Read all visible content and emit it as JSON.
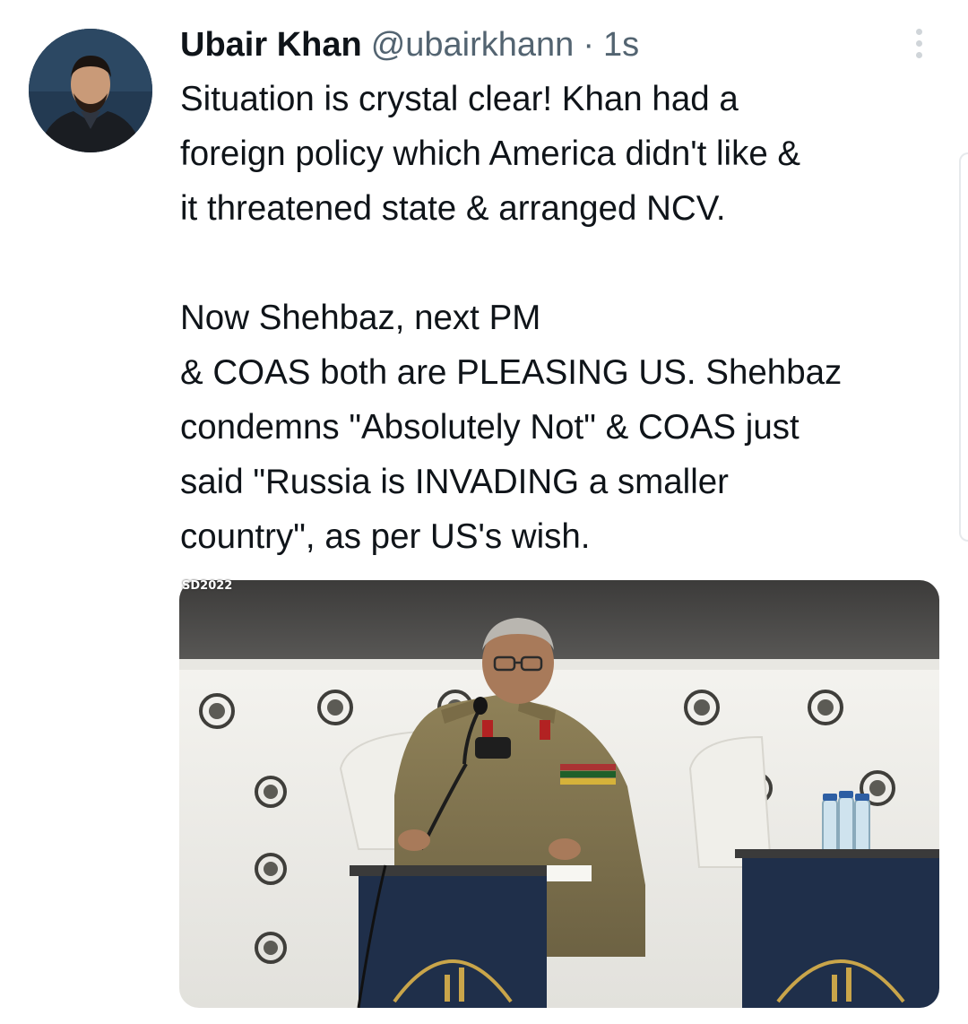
{
  "tweet": {
    "author": {
      "display_name": "Ubair Khan",
      "handle": "@ubairkhann",
      "avatar_icon": "profile-photo"
    },
    "separator": "·",
    "timestamp": "1s",
    "more_icon": "more-options-icon",
    "text_lines_para1": [
      "Situation is crystal clear! Khan had a",
      "foreign policy which America didn't like &",
      "it threatened state & arranged NCV."
    ],
    "text_lines_para2": [
      "Now Shehbaz, next PM",
      "& COAS both are PLEASING US. Shehbaz",
      "condemns \"Absolutely Not\" & COAS just",
      "said \"Russia is INVADING a smaller",
      "country\", as per US's wish."
    ],
    "media": {
      "watermark": "SD2022",
      "type": "photo"
    }
  },
  "colors": {
    "text_primary": "#0f1419",
    "text_secondary": "#536471",
    "background": "#ffffff"
  }
}
